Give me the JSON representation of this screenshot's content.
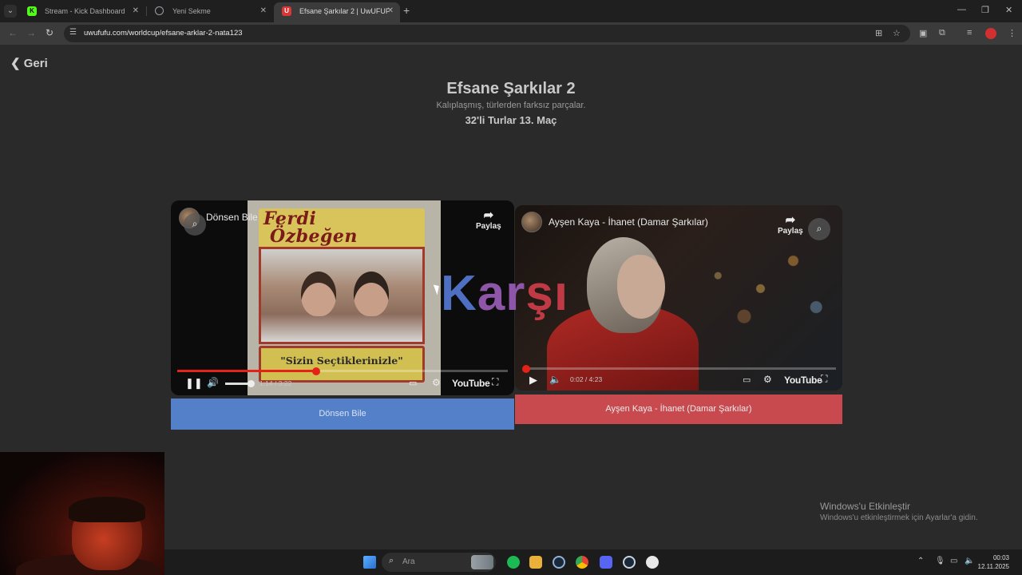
{
  "browser": {
    "tabs": [
      {
        "title": "Stream - Kick Dashboard",
        "favicon_color": "#53fc18",
        "favicon_letter": "K"
      },
      {
        "title": "Yeni Sekme",
        "favicon_color": "#9aa0a6",
        "favicon_letter": ""
      },
      {
        "title": "Efsane Şarkılar 2 | UwUFUF",
        "favicon_color": "#d93636",
        "favicon_letter": "U"
      }
    ],
    "active_tab_index": 2,
    "url": "uwufufu.com/worldcup/efsane-arklar-2-nata123"
  },
  "page": {
    "back_label": "Geri",
    "title": "Efsane Şarkılar 2",
    "subtitle": "Kalıplaşmış, türlerden farksız parçalar.",
    "round": "32'li Turlar 13. Maç",
    "versus": {
      "a": "K",
      "b": "ar",
      "c": "şı"
    },
    "left": {
      "video_title": "Dönsen Bile",
      "share_label": "Paylaş",
      "time": "1:14 / 3:22",
      "progress": 0.42,
      "volume": 0.5,
      "playing": true,
      "album_brand_line1": "Ferdi",
      "album_brand_line2": "Özbeğen",
      "album_banner": "\"Sizin Seçtiklerinizle\"",
      "brand": "YouTube",
      "choice_label": "Dönsen Bile",
      "choice_color": "#5480c9"
    },
    "right": {
      "video_title": "Ayşen Kaya - İhanet (Damar Şarkılar)",
      "share_label": "Paylaş",
      "time": "0:02 / 4:23",
      "progress": 0.01,
      "playing": false,
      "brand": "YouTube",
      "choice_label": "Ayşen Kaya - İhanet (Damar Şarkılar)",
      "choice_color": "#c84a4f"
    }
  },
  "watermark": {
    "title": "Windows'u Etkinleştir",
    "text": "Windows'u etkinleştirmek için Ayarlar'a gidin."
  },
  "taskbar": {
    "search_placeholder": "Ara",
    "time": "00:03",
    "date": "12.11.2025"
  }
}
